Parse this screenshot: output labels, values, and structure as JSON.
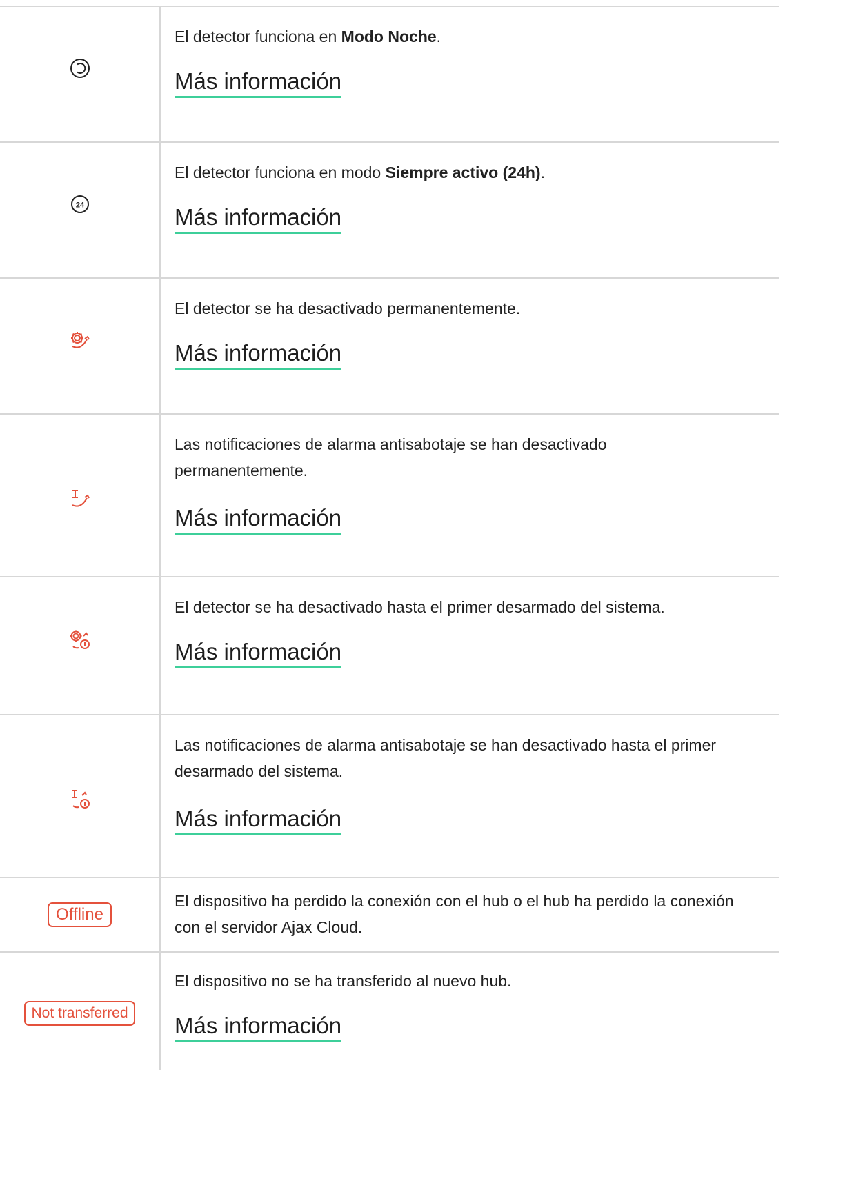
{
  "rows": [
    {
      "icon": "night-mode-icon",
      "desc_pre": "El detector funciona en ",
      "desc_bold": "Modo Noche",
      "desc_post": ".",
      "link": "Más información"
    },
    {
      "icon": "always-active-24h-icon",
      "icon_text": "24",
      "desc_pre": "El detector funciona en modo ",
      "desc_bold": "Siempre activo (24h)",
      "desc_post": ".",
      "link": "Más información"
    },
    {
      "icon": "detector-disabled-permanently-icon",
      "desc": "El detector se ha desactivado permanentemente.",
      "link": "Más información"
    },
    {
      "icon": "tamper-notifications-disabled-permanently-icon",
      "desc": "Las notificaciones de alarma antisabotaje se han desactivado permanentemente.",
      "link": "Más información"
    },
    {
      "icon": "detector-disabled-until-disarm-icon",
      "desc": "El detector se ha desactivado hasta el primer desarmado del sistema.",
      "link": "Más información"
    },
    {
      "icon": "tamper-notifications-disabled-until-disarm-icon",
      "desc": "Las notificaciones de alarma antisabotaje se han desactivado hasta el primer desarmado del sistema.",
      "link": "Más información"
    },
    {
      "badge": "Offline",
      "desc": "El dispositivo ha perdido la conexión con el hub o el hub ha perdido la conexión con el servidor Ajax Cloud."
    },
    {
      "badge": "Not transferred",
      "desc": "El dispositivo no se ha transferido al nuevo hub.",
      "link": "Más información"
    }
  ],
  "colors": {
    "accent_red": "#e4513c",
    "link_underline": "#3ecf9a",
    "border": "#d7d7d7"
  }
}
